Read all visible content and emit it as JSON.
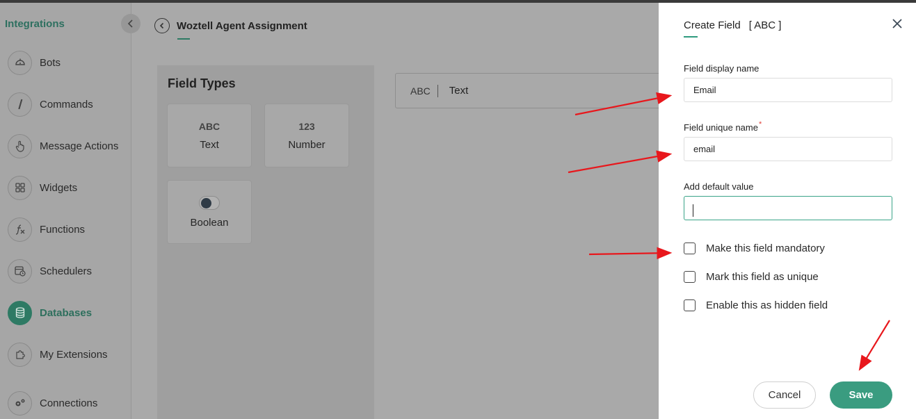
{
  "sidebar": {
    "title": "Integrations",
    "items": [
      {
        "label": "Bots",
        "icon": "bot-icon"
      },
      {
        "label": "Commands",
        "icon": "slash-icon"
      },
      {
        "label": "Message Actions",
        "icon": "hand-pointer-icon"
      },
      {
        "label": "Widgets",
        "icon": "grid-icon"
      },
      {
        "label": "Functions",
        "icon": "function-icon"
      },
      {
        "label": "Schedulers",
        "icon": "calendar-clock-icon"
      },
      {
        "label": "Databases",
        "icon": "database-icon",
        "active": true
      },
      {
        "label": "My Extensions",
        "icon": "puzzle-icon"
      },
      {
        "label": "Connections",
        "icon": "gears-icon"
      }
    ]
  },
  "main": {
    "title": "Woztell Agent Assignment",
    "field_types": {
      "title": "Field Types",
      "items": [
        {
          "symbol": "ABC",
          "label": "Text"
        },
        {
          "symbol": "123",
          "label": "Number"
        },
        {
          "symbol": "toggle",
          "label": "Boolean"
        }
      ]
    },
    "field_row": {
      "symbol": "ABC",
      "label": "Text"
    }
  },
  "panel": {
    "title": "Create Field",
    "title_tag": "[ ABC ]",
    "fields": {
      "display_name": {
        "label": "Field display name",
        "value": "Email"
      },
      "unique_name": {
        "label": "Field unique name",
        "required_mark": "*",
        "value": "email"
      },
      "default_value": {
        "label": "Add default value",
        "value": ""
      }
    },
    "checkboxes": [
      {
        "label": "Make this field mandatory",
        "checked": false
      },
      {
        "label": "Mark this field as unique",
        "checked": false
      },
      {
        "label": "Enable this as hidden field",
        "checked": false
      }
    ],
    "buttons": {
      "cancel": "Cancel",
      "save": "Save"
    }
  },
  "colors": {
    "accent": "#3a9c80",
    "overlay": "#a9a9a9",
    "annotation_arrow": "#e8171c"
  }
}
